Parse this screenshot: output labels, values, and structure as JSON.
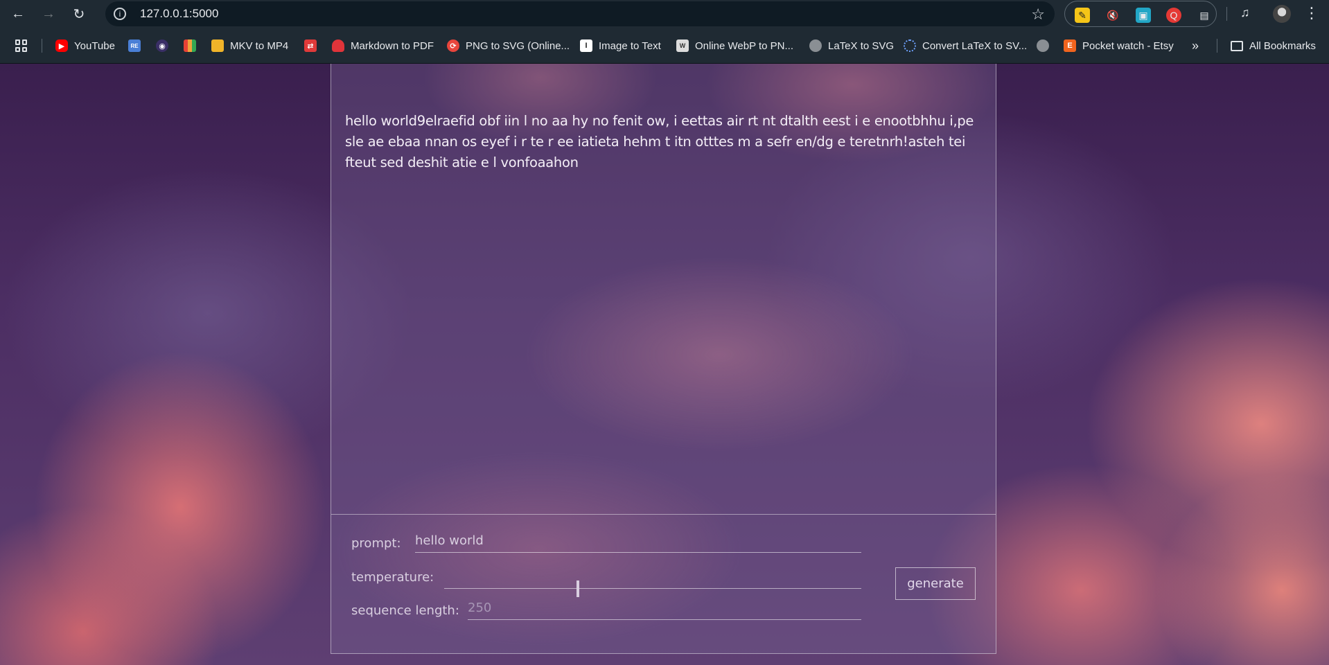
{
  "browser": {
    "url": "127.0.0.1:5000",
    "bookmarks": [
      {
        "label": "YouTube",
        "icon": "youtube-icon",
        "color": "#ff0000"
      },
      {
        "label": "",
        "icon": "repo-icon",
        "color": "#4a7fd6"
      },
      {
        "label": "",
        "icon": "fingerprint-icon",
        "color": "#7a6fd0"
      },
      {
        "label": "",
        "icon": "colorful-grid-icon",
        "color": "#f2a23c"
      },
      {
        "label": "MKV to MP4",
        "icon": "folder-stack-icon",
        "color": "#f0b429"
      },
      {
        "label": "",
        "icon": "swap-icon",
        "color": "#e03a3a"
      },
      {
        "label": "Markdown to PDF",
        "icon": "flame-icon",
        "color": "#e0343a"
      },
      {
        "label": "PNG to SVG (Online...",
        "icon": "converter-icon",
        "color": "#e8453c"
      },
      {
        "label": "Image to Text",
        "icon": "text-doc-icon",
        "color": "#ffffff"
      },
      {
        "label": "Online WebP to PN...",
        "icon": "webp-icon",
        "color": "#dcdcdc"
      },
      {
        "label": "LaTeX to SVG",
        "icon": "globe-icon",
        "color": "#c8c8c8"
      },
      {
        "label": "Convert LaTeX to SV...",
        "icon": "dotted-circle-icon",
        "color": "#6fa3ff"
      },
      {
        "label": "",
        "icon": "globe-icon",
        "color": "#c8c8c8"
      },
      {
        "label": "Pocket watch - Etsy",
        "icon": "etsy-icon",
        "color": "#f1641e"
      }
    ],
    "more_label": "»",
    "all_bookmarks_label": "All Bookmarks"
  },
  "app": {
    "output_text": "hello world9elraefid obf iin l no aa hy no fenit ow, i eettas air rt nt dtalth eest i e enootbhhu i,pe sle ae ebaa nnan os eyef i r te r ee iatieta hehm t itn otttes m a sefr en/dg e teretnrh!asteh tei fteut sed deshit atie e l vonfoaahon",
    "prompt_label": "prompt:",
    "prompt_value": "hello world",
    "temperature_label": "temperature:",
    "temperature_fraction": 0.32,
    "sequence_label": "sequence length:",
    "sequence_placeholder": "250",
    "generate_label": "generate"
  }
}
